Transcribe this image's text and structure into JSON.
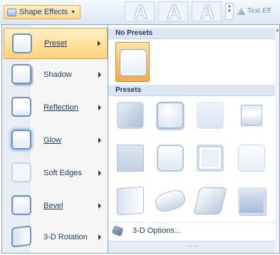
{
  "ribbon": {
    "shape_effects_label": "Shape Effects",
    "text_effects_label": "Text Eff",
    "wordart_glyph": "A"
  },
  "menu": {
    "items": [
      {
        "label": "Preset",
        "active": true
      },
      {
        "label": "Shadow"
      },
      {
        "label": "Reflection"
      },
      {
        "label": "Glow"
      },
      {
        "label": "Soft Edges"
      },
      {
        "label": "Bevel"
      },
      {
        "label": "3-D Rotation"
      }
    ]
  },
  "gallery": {
    "no_presets_header": "No Presets",
    "presets_header": "Presets",
    "options_label": "3-D Options...",
    "grip": "....",
    "presets_count": 12
  },
  "colors": {
    "accent_hover": "#ffd27a",
    "header_bg": "#dde7f4",
    "text": "#1e395b"
  }
}
